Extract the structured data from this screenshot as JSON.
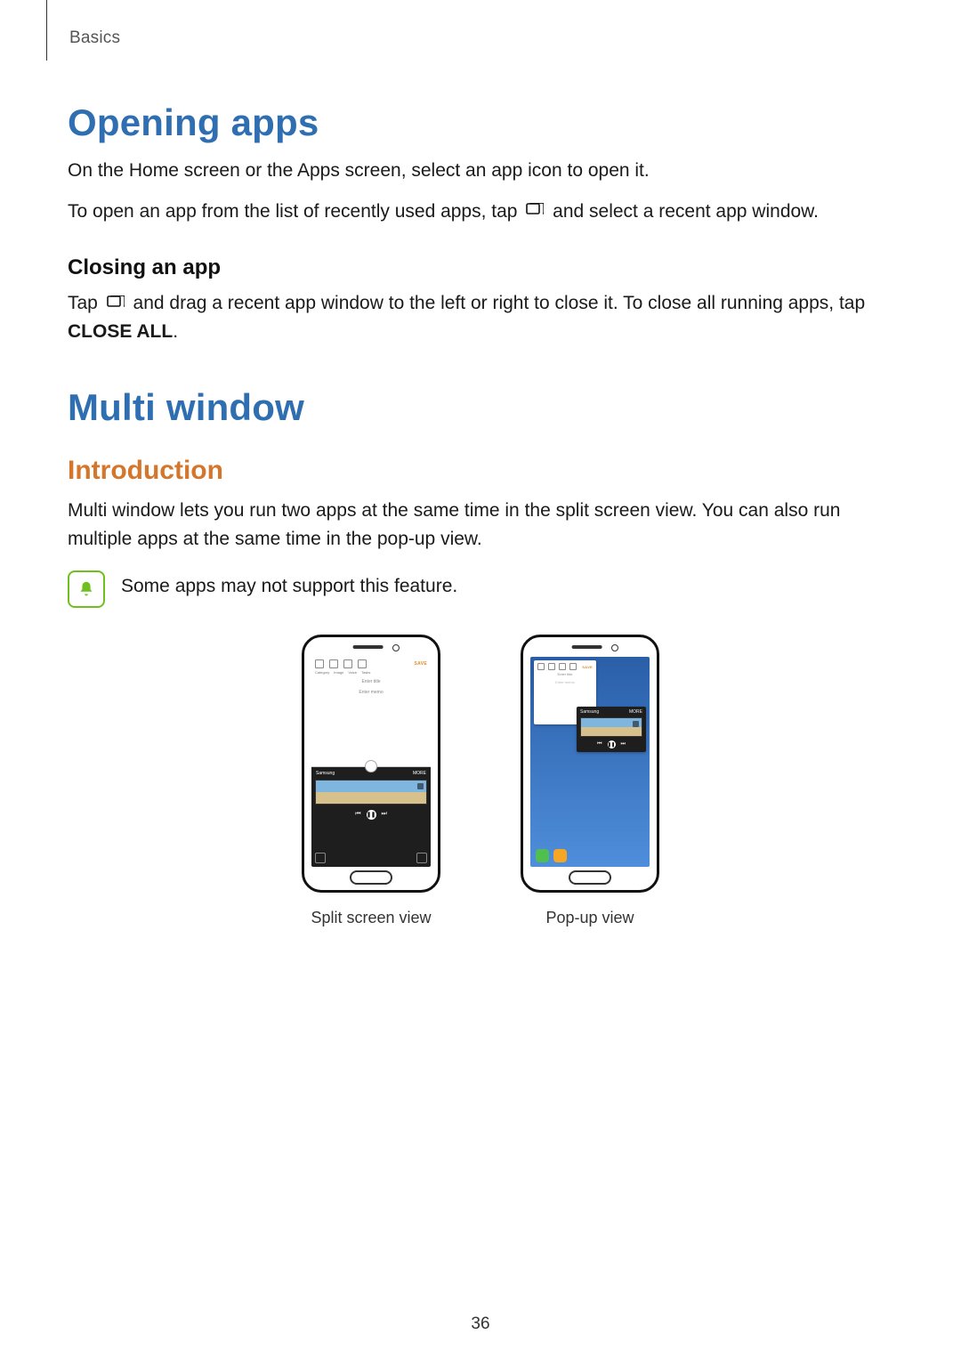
{
  "breadcrumb": "Basics",
  "page_number": "36",
  "opening_apps": {
    "heading": "Opening apps",
    "p1_a": "On the Home screen or the Apps screen, select an app icon to open it.",
    "p2_a": "To open an app from the list of recently used apps, tap ",
    "p2_b": " and select a recent app window.",
    "closing_heading": "Closing an app",
    "p3_a": "Tap ",
    "p3_b": " and drag a recent app window to the left or right to close it. To close all running apps, tap ",
    "p3_close_all": "CLOSE ALL",
    "p3_c": "."
  },
  "multi_window": {
    "heading": "Multi window",
    "intro_heading": "Introduction",
    "intro_body": "Multi window lets you run two apps at the same time in the split screen view. You can also run multiple apps at the same time in the pop-up view.",
    "note": "Some apps may not support this feature.",
    "split_caption": "Split screen view",
    "popup_caption": "Pop-up view"
  },
  "phone": {
    "toolbar_labels": [
      "Category",
      "Image",
      "Voice",
      "Tasks"
    ],
    "save": "SAVE",
    "enter_title": "Enter title",
    "enter_memo": "Enter memo",
    "samsung": "Samsung",
    "more": "MORE"
  }
}
